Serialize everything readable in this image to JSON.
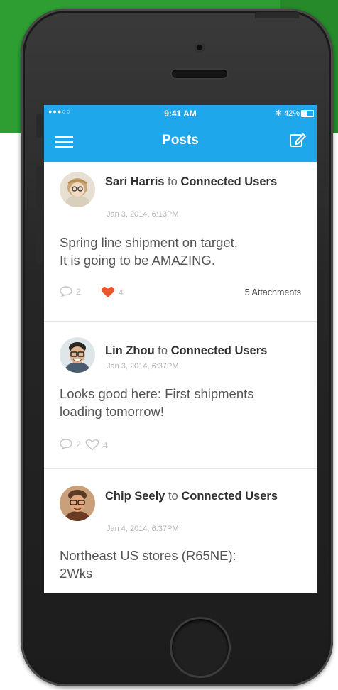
{
  "status_bar": {
    "signal": "●●●○○",
    "time": "9:41 AM",
    "battery_text": "✻ 42%",
    "battery_level": 0.42
  },
  "nav": {
    "title": "Posts",
    "menu_icon": "hamburger-menu-icon",
    "compose_icon": "edit-compose-icon"
  },
  "posts": [
    {
      "author": "Sari Harris",
      "to": "to",
      "group": "Connected Users",
      "date": "Jan 3, 2014, 6:13PM",
      "text_line1": "Spring line shipment on target.",
      "text_line2": "It is going to be AMAZING.",
      "comments": "2",
      "likes": "4",
      "liked": true,
      "attachments": "5 Attachments"
    },
    {
      "author": "Lin Zhou",
      "to": "to",
      "group": "Connected Users",
      "date": "Jan 3, 2014, 6:37PM",
      "text_line1": "Looks good here: First shipments",
      "text_line2": "loading tomorrow!",
      "comments": "2",
      "likes": "4",
      "liked": false
    },
    {
      "author": "Chip Seely",
      "to": "to",
      "group": "Connected Users",
      "date": "Jan 4, 2014, 6:37PM",
      "text_line1": "Northeast US stores (R65NE):",
      "text_line2": "2Wks"
    }
  ],
  "colors": {
    "accent": "#1ea7ea",
    "background": "#2e9e32",
    "like_active": "#e8552c",
    "icon_muted": "#c4c4c4"
  }
}
